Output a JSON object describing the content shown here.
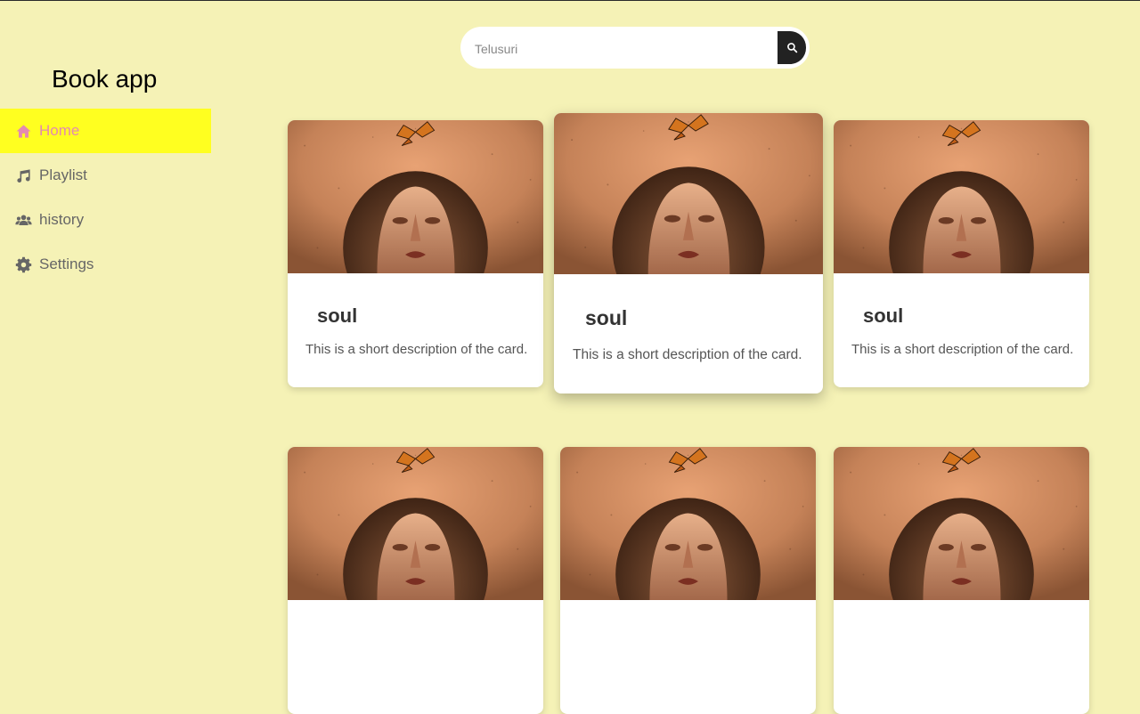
{
  "app": {
    "title": "Book app"
  },
  "sidebar": {
    "items": [
      {
        "label": "Home",
        "icon": "home-icon",
        "active": true
      },
      {
        "label": "Playlist",
        "icon": "music-icon",
        "active": false
      },
      {
        "label": "history",
        "icon": "users-icon",
        "active": false
      },
      {
        "label": "Settings",
        "icon": "gear-icon",
        "active": false
      }
    ]
  },
  "search": {
    "placeholder": "Telusuri",
    "value": "",
    "button_icon": "search-icon"
  },
  "cards": [
    {
      "title": "soul",
      "description": "This is a short description of the card."
    },
    {
      "title": "soul",
      "description": "This is a short description of the card."
    },
    {
      "title": "soul",
      "description": "This is a short description of the card."
    },
    {
      "title": "",
      "description": ""
    },
    {
      "title": "",
      "description": ""
    },
    {
      "title": "",
      "description": ""
    }
  ],
  "colors": {
    "background": "#f5f2b6",
    "active_item": "#ffff20",
    "active_text": "#e48ab0",
    "search_button": "#222222"
  }
}
